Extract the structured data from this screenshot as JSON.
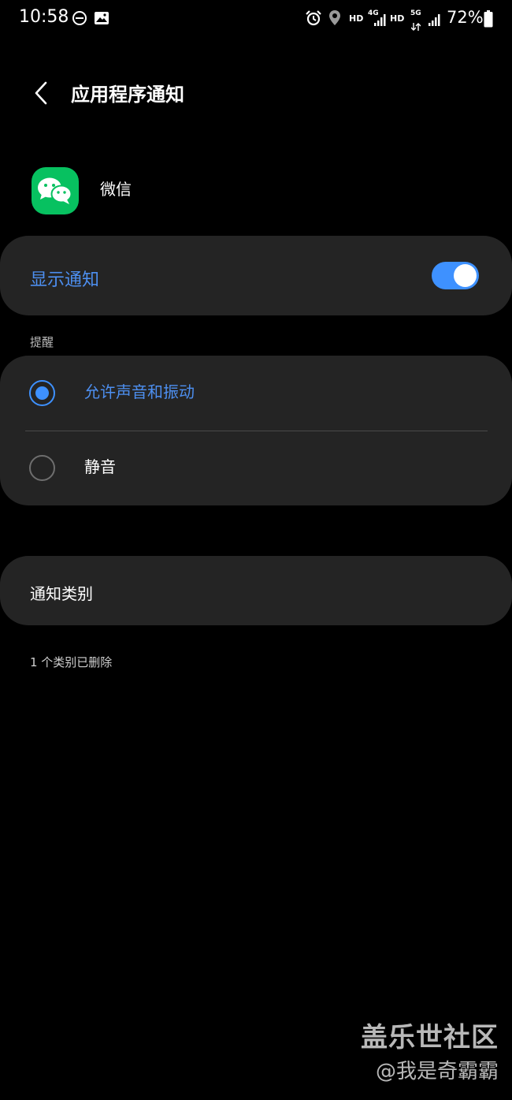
{
  "status_bar": {
    "time": "10:58",
    "hd1": "HD",
    "net1": "4G",
    "hd2": "HD",
    "net2": "5G",
    "battery": "72%"
  },
  "header": {
    "title": "应用程序通知"
  },
  "app": {
    "name": "微信",
    "icon": "wechat-icon",
    "icon_color": "#07c160"
  },
  "show_notifications": {
    "label": "显示通知",
    "enabled": true,
    "accent": "#3e91ff"
  },
  "alert_section": {
    "label": "提醒",
    "options": [
      {
        "label": "允许声音和振动",
        "selected": true
      },
      {
        "label": "静音",
        "selected": false
      }
    ]
  },
  "categories": {
    "label": "通知类别",
    "deleted_note": "1 个类别已删除"
  },
  "watermark": {
    "title": "盖乐世社区",
    "user": "@我是奇霸霸"
  }
}
